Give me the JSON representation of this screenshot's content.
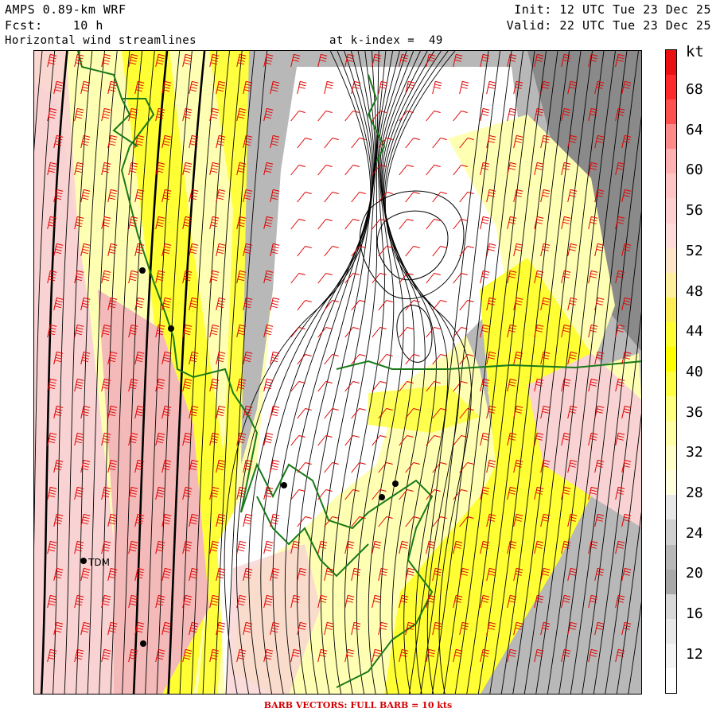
{
  "header": {
    "model": "AMPS 0.89-km WRF",
    "init": "Init: 12 UTC Tue 23 Dec 25",
    "fcst": "Fcst:    10 h",
    "valid": "Valid: 22 UTC Tue 23 Dec 25",
    "field": "Horizontal wind streamlines",
    "level": "at k-index =  49"
  },
  "map": {
    "fill_colors": {
      "low": "#ffffff",
      "gray": "#b8b8b8",
      "dark_gray": "#8a8a8a",
      "light_yellow": "#ffffb4",
      "yellow": "#ffff33",
      "light_pink": "#f9d3d3",
      "pink": "#f4b9b9",
      "red": "#e02020"
    },
    "coastline_color": "#1a7a1a",
    "barb_color": "#e00000",
    "streamline_color": "#000000",
    "station_label": "TDM"
  },
  "colorbar": {
    "unit": "kt",
    "ticks": [
      "68",
      "64",
      "60",
      "56",
      "52",
      "48",
      "44",
      "40",
      "36",
      "32",
      "28",
      "24",
      "20",
      "16",
      "12"
    ],
    "colors": [
      "#e81010",
      "#ff2a2a",
      "#ff5050",
      "#ff8a8a",
      "#ffb0b0",
      "#ffc4c4",
      "#ffd0d0",
      "#ffdcdc",
      "#ffe6c8",
      "#fff0a0",
      "#ffee55",
      "#ffff33",
      "#ffff00",
      "#ffff44",
      "#ffff80",
      "#ffffa8",
      "#ffffc8",
      "#ffffe0",
      "#e8e8e8",
      "#d0d0d0",
      "#b8b8b8",
      "#a8a8a8",
      "#d8d8d8",
      "#e8e8e8",
      "#f4f4f4",
      "#ffffff"
    ]
  },
  "footer": "BARB VECTORS:  FULL BARB = 10 kts"
}
